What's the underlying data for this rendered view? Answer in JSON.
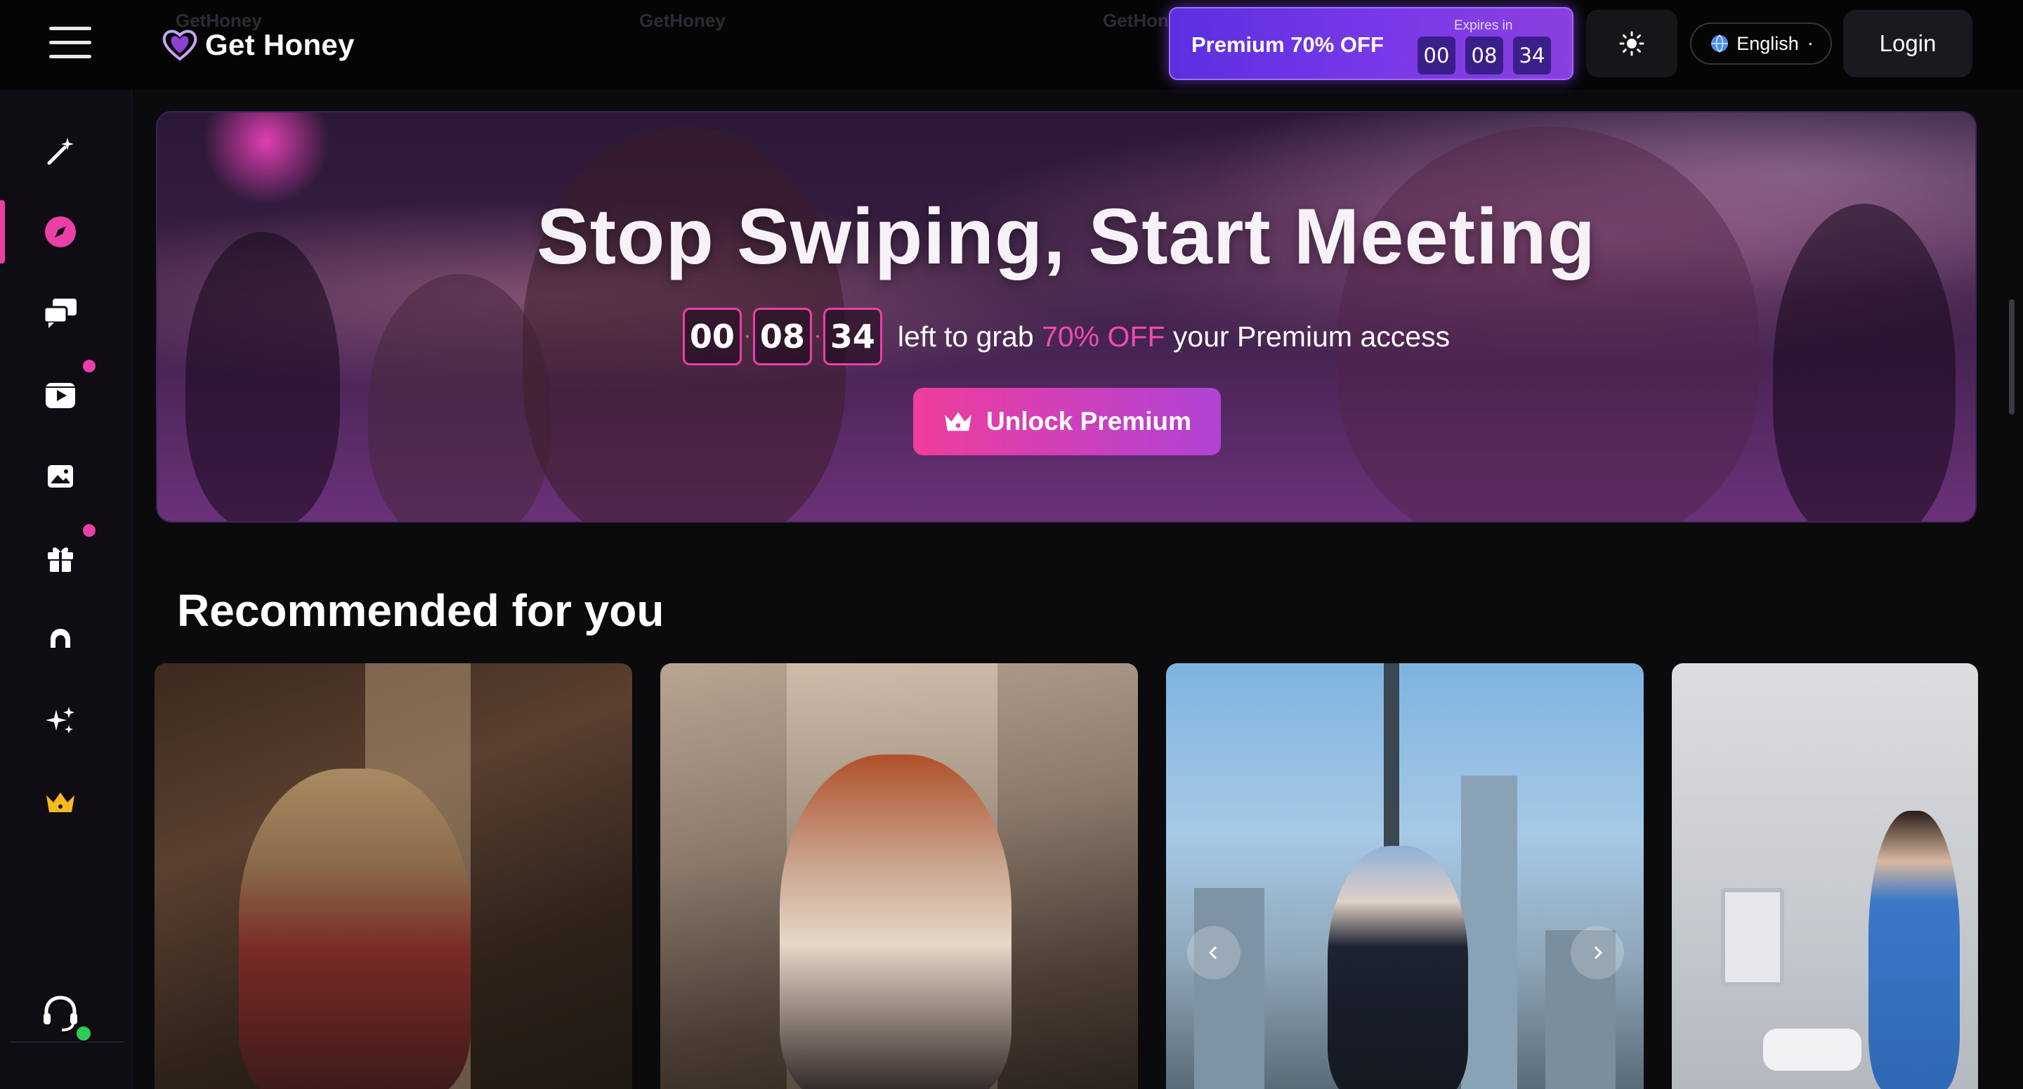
{
  "header": {
    "logo_text": "Get Honey",
    "watermarks": [
      "GetHoney",
      "GetHoney",
      "GetHon"
    ],
    "promo": {
      "title": "Premium 70% OFF",
      "expires_label": "Expires in",
      "hours": "00",
      "minutes": "08",
      "seconds": "34"
    },
    "theme_icon": "sun-icon",
    "language": "English",
    "login_label": "Login"
  },
  "sidebar": {
    "items": [
      {
        "name": "magic-wand-icon",
        "active": false,
        "dot": false
      },
      {
        "name": "compass-icon",
        "active": true,
        "dot": false
      },
      {
        "name": "chat-icon",
        "active": false,
        "dot": false
      },
      {
        "name": "video-icon",
        "active": false,
        "dot": true
      },
      {
        "name": "image-icon",
        "active": false,
        "dot": false
      },
      {
        "name": "gift-icon",
        "active": false,
        "dot": true
      },
      {
        "name": "headphones-mask-icon",
        "active": false,
        "dot": false
      },
      {
        "name": "sparkles-icon",
        "active": false,
        "dot": false
      },
      {
        "name": "crown-icon",
        "active": false,
        "dot": false
      }
    ],
    "support_icon": "headset-icon",
    "colors": {
      "accent": "#ec3fa6",
      "crown": "#f6b91f"
    }
  },
  "hero": {
    "title": "Stop Swiping, Start Meeting",
    "countdown": {
      "hours": "00",
      "minutes": "08",
      "seconds": "34"
    },
    "text_before": "left to grab",
    "highlight": "70% OFF",
    "text_after": "your Premium access",
    "button_label": "Unlock Premium"
  },
  "recommended": {
    "title": "Recommended for you",
    "cards": [
      {
        "name": "profile-card-1"
      },
      {
        "name": "profile-card-2"
      },
      {
        "name": "profile-card-3"
      },
      {
        "name": "profile-card-4"
      }
    ]
  }
}
